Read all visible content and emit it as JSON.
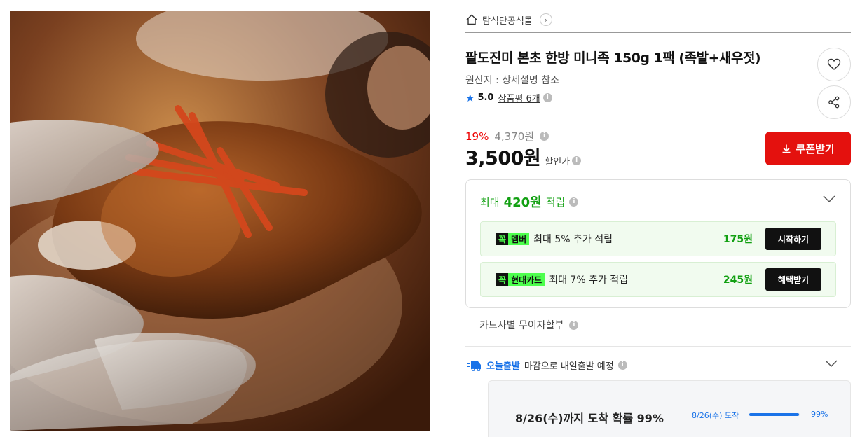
{
  "breadcrumb": {
    "store": "탐식단공식몰"
  },
  "product": {
    "title": "팔도진미 본초 한방 미니족 150g 1팩 (족발+새우젓)",
    "origin": "원산지 : 상세설명 참조",
    "rating": "5.0",
    "review_label": "상품평 6개"
  },
  "price": {
    "discount_rate": "19%",
    "original": "4,370원",
    "sale": "3,500원",
    "sale_label": "할인가"
  },
  "coupon": {
    "label": "쿠폰받기"
  },
  "reward": {
    "prefix": "최대",
    "amount": "420원",
    "suffix": "적립",
    "offers": [
      {
        "badge_k": "꼭",
        "badge_name": "멤버",
        "text": "최대 5% 추가 적립",
        "amount": "175원",
        "button": "시작하기"
      },
      {
        "badge_k": "꼭",
        "badge_name": "현대카드",
        "text": "최대 7% 추가 적립",
        "amount": "245원",
        "button": "혜택받기"
      }
    ]
  },
  "installment": {
    "label": "카드사별 무이자할부"
  },
  "shipping": {
    "brand": "오늘출발",
    "text": "마감으로 내일출발 예정",
    "arrival_title": "8/26(수)까지 도착 확률 99%",
    "arrival_date": "8/26(수) 도착",
    "arrival_pct": "99%",
    "arrival_fraction": 0.99
  },
  "colors": {
    "accent_red": "#e4110e",
    "reward_green": "#12a012",
    "ship_blue": "#1a73e8"
  },
  "icons": [
    "home-icon",
    "chevron-right-icon",
    "star-icon",
    "info-icon",
    "heart-icon",
    "share-icon",
    "download-icon",
    "chevron-down-icon",
    "delivery-icon"
  ]
}
